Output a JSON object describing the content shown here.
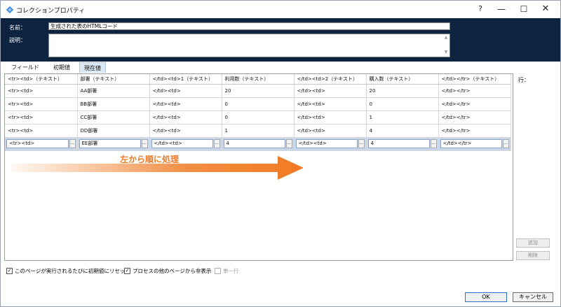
{
  "window": {
    "title": "コレクションプロパティ",
    "help_label": "?",
    "min_label": "—",
    "max_label": "☐",
    "close_label": "✕"
  },
  "header": {
    "name_label": "名前：",
    "name_value": "生成された表のHTMLコード",
    "desc_label": "説明：",
    "desc_value": ""
  },
  "tabs": [
    {
      "label": "フィールド"
    },
    {
      "label": "初期値"
    },
    {
      "label": "現在値"
    }
  ],
  "grid": {
    "columns": [
      "<tr><td>（テキスト）",
      "部署（テキスト）",
      "</td><td>1（テキスト）",
      "利用数（テキスト）",
      "</td><td>2（テキスト）",
      "購入数（テキスト）",
      "</td></tr>（テキスト）"
    ],
    "rows": [
      [
        "<tr><td>",
        "AA部署",
        "</td><td>",
        "20",
        "</td><td>",
        "20",
        "</td></tr>"
      ],
      [
        "<tr><td>",
        "BB部署",
        "</td><td>",
        "0",
        "</td><td>",
        "0",
        "</td></tr>"
      ],
      [
        "<tr><td>",
        "CC部署",
        "</td><td>",
        "0",
        "</td><td>",
        "1",
        "</td></tr>"
      ],
      [
        "<tr><td>",
        "DD部署",
        "</td><td>",
        "1",
        "</td><td>",
        "4",
        "</td></tr>"
      ]
    ],
    "active_row": [
      "<tr><td>",
      "EE部署",
      "</td><td>",
      "4",
      "</td><td>",
      "4",
      "</td></tr>"
    ],
    "ellipsis_label": "..."
  },
  "annotation": {
    "text": "左から順に処理",
    "color": "#f07a23"
  },
  "side": {
    "row_label": "行：",
    "add_label": "追加",
    "delete_label": "削除"
  },
  "options": {
    "reset_label": "このページが実行されるたびに初期値にリセット",
    "reset_checked": "✓",
    "hide_label": "プロセスの他のページから非表示",
    "hide_checked": "✓",
    "single_row_label": "単一行"
  },
  "footer": {
    "ok_label": "OK",
    "cancel_label": "キャンセル"
  }
}
